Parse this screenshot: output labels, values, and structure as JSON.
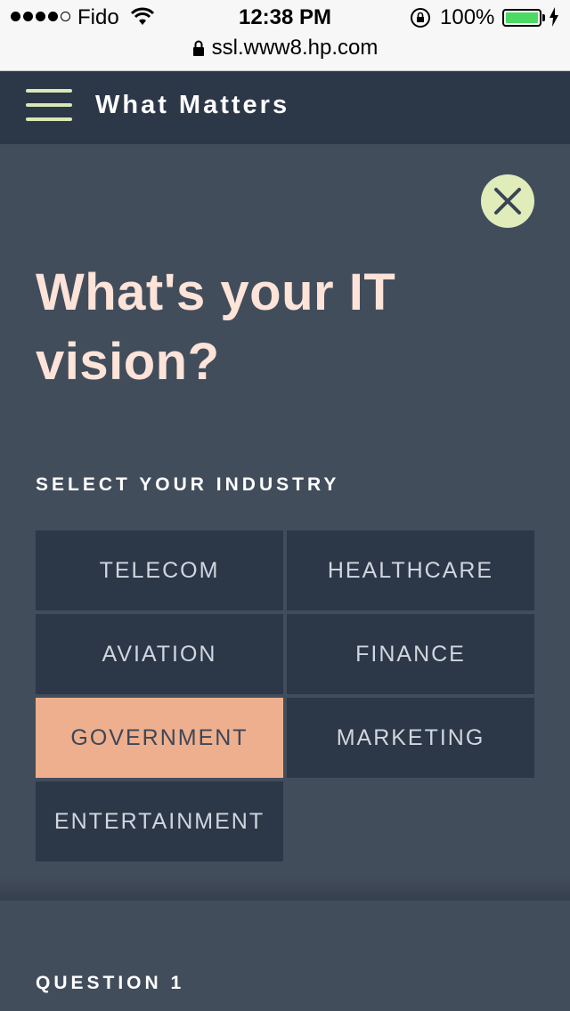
{
  "status_bar": {
    "carrier": "Fido",
    "time": "12:38 PM",
    "battery": "100%",
    "url": "ssl.www8.hp.com"
  },
  "header": {
    "title": "What Matters"
  },
  "hero": {
    "headline": "What's your IT vision?"
  },
  "industry": {
    "label": "SELECT YOUR INDUSTRY",
    "options": [
      "TELECOM",
      "HEALTHCARE",
      "AVIATION",
      "FINANCE",
      "GOVERNMENT",
      "MARKETING",
      "ENTERTAINMENT"
    ],
    "selected": "GOVERNMENT"
  },
  "question": {
    "label": "QUESTION 1"
  },
  "colors": {
    "background": "#424d5c",
    "header": "#2c3748",
    "accent_selected": "#eeaf8e",
    "close_button": "#e0ecb9",
    "headline": "#fde3d8"
  }
}
